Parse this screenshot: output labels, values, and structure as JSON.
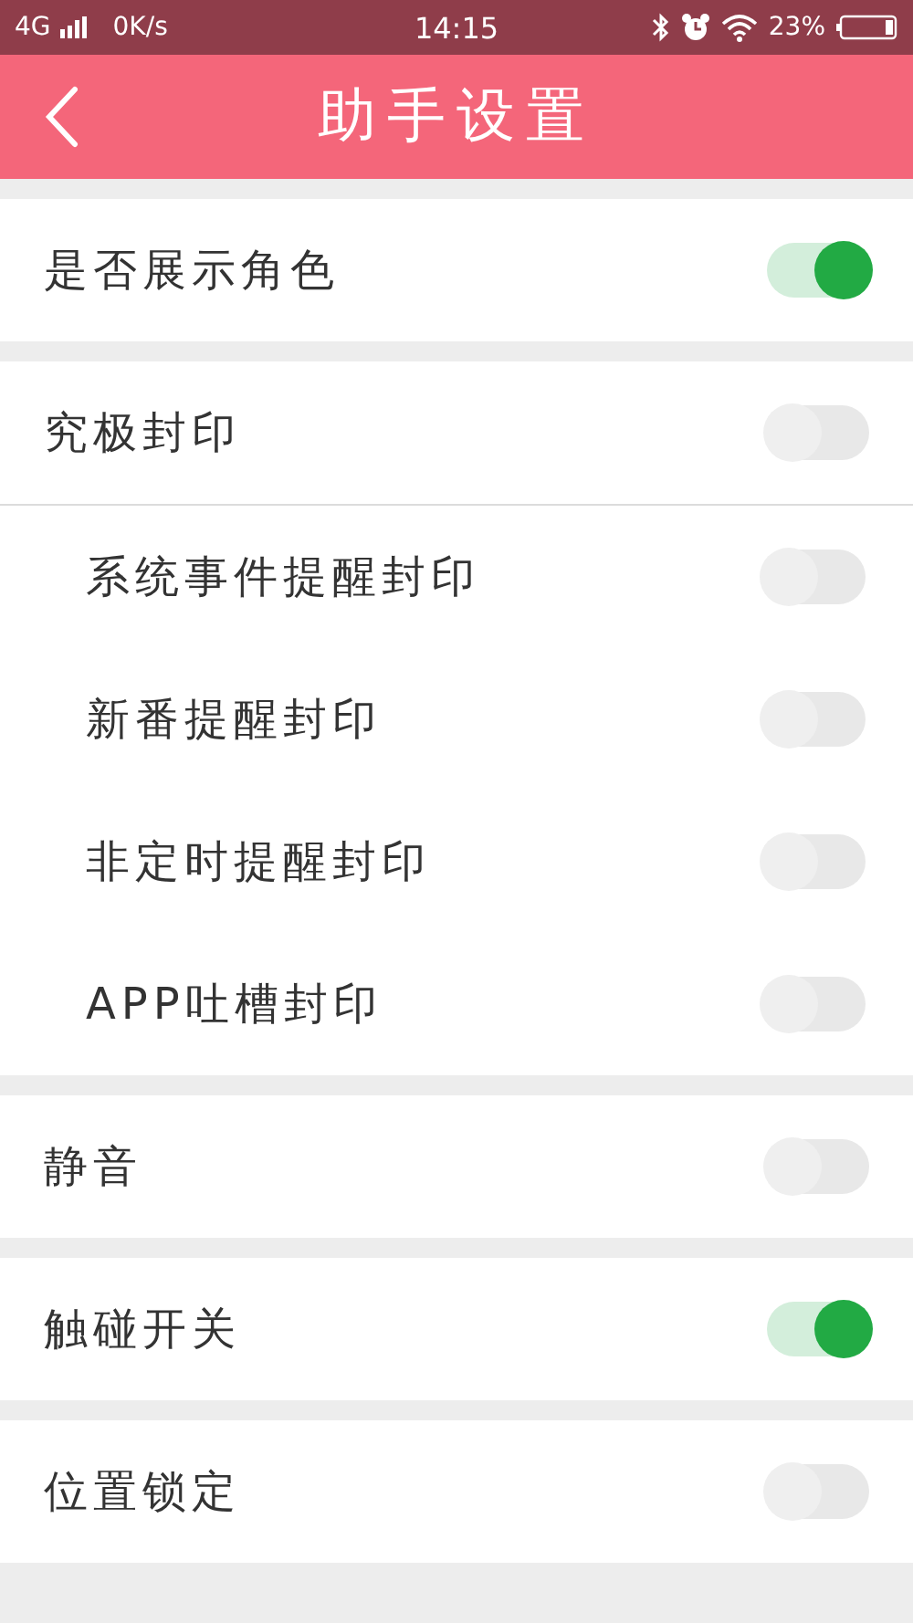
{
  "status_bar": {
    "network": "4G",
    "speed": "0K/s",
    "time": "14:15",
    "battery": "23%"
  },
  "header": {
    "title": "助手设置"
  },
  "sections": [
    {
      "rows": [
        {
          "kind": "main",
          "label": "是否展示角色",
          "on": true
        }
      ]
    },
    {
      "rows": [
        {
          "kind": "main",
          "label": "究极封印",
          "on": false
        },
        {
          "kind": "sub",
          "label": "系统事件提醒封印",
          "on": false
        },
        {
          "kind": "sub",
          "label": "新番提醒封印",
          "on": false
        },
        {
          "kind": "sub",
          "label": "非定时提醒封印",
          "on": false
        },
        {
          "kind": "sub",
          "label": "APP吐槽封印",
          "on": false
        }
      ]
    },
    {
      "rows": [
        {
          "kind": "main",
          "label": "静音",
          "on": false
        }
      ]
    },
    {
      "rows": [
        {
          "kind": "main",
          "label": "触碰开关",
          "on": true
        }
      ]
    },
    {
      "rows": [
        {
          "kind": "main",
          "label": "位置锁定",
          "on": false
        }
      ]
    }
  ]
}
